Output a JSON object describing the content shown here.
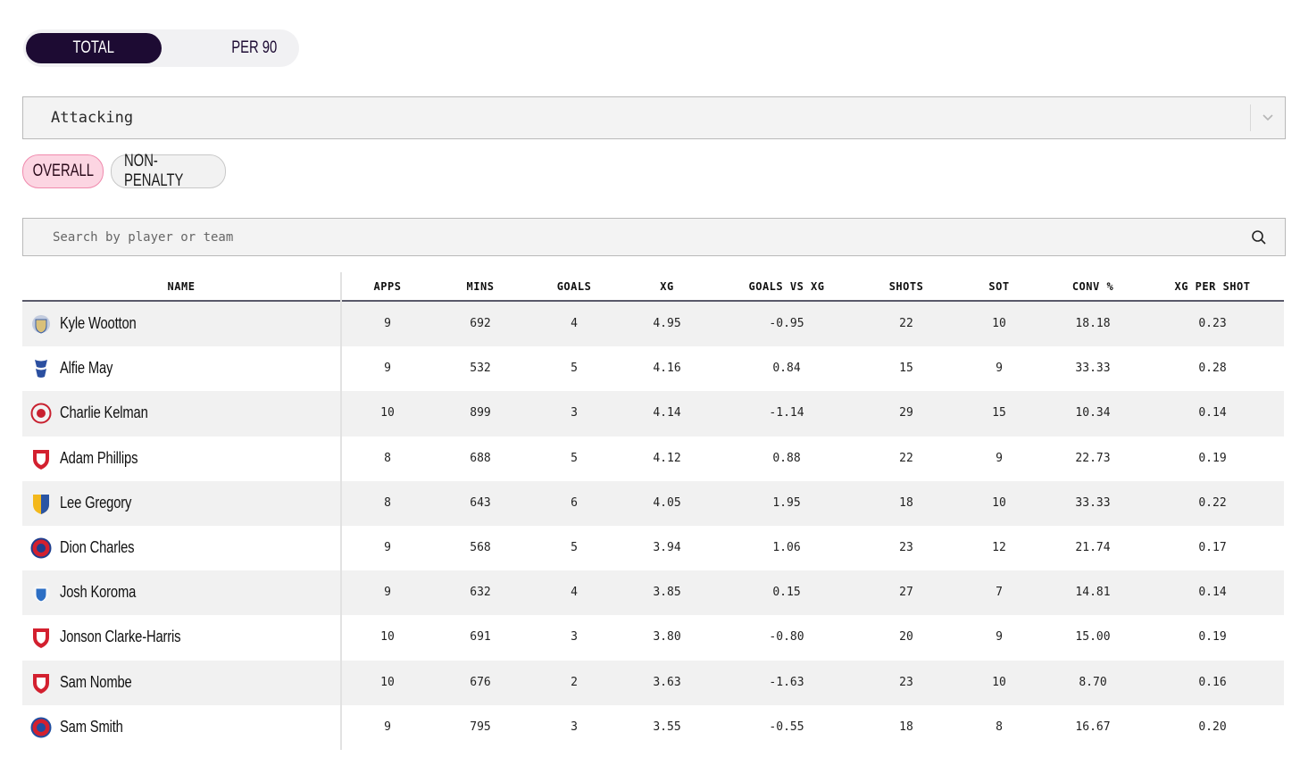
{
  "toggle": {
    "total": "TOTAL",
    "per90": "PER 90"
  },
  "category_select": {
    "value": "Attacking"
  },
  "filters": {
    "overall": "OVERALL",
    "non_penalty": "NON-PENALTY"
  },
  "search": {
    "placeholder": "Search by player or team",
    "icon": "search-icon"
  },
  "table": {
    "headers": [
      "NAME",
      "APPS",
      "MINS",
      "GOALS",
      "XG",
      "GOALS VS XG",
      "SHOTS",
      "SOT",
      "CONV %",
      "XG PER SHOT"
    ],
    "rows": [
      {
        "name": "Kyle Wootton",
        "cells": [
          "9",
          "692",
          "4",
          "4.95",
          "-0.95",
          "22",
          "10",
          "18.18",
          "0.23"
        ],
        "badge": "stockport-crest",
        "colors": [
          "#d9c07a",
          "#3a5fa8"
        ]
      },
      {
        "name": "Alfie May",
        "cells": [
          "9",
          "532",
          "5",
          "4.16",
          "0.84",
          "15",
          "9",
          "33.33",
          "0.28"
        ],
        "badge": "birmingham-crest",
        "colors": [
          "#2b4fa0",
          "#ffffff"
        ]
      },
      {
        "name": "Charlie Kelman",
        "cells": [
          "10",
          "899",
          "3",
          "4.14",
          "-1.14",
          "29",
          "15",
          "10.34",
          "0.14"
        ],
        "badge": "leyton-orient-crest",
        "colors": [
          "#c8202f",
          "#f2f2f2"
        ]
      },
      {
        "name": "Adam Phillips",
        "cells": [
          "8",
          "688",
          "5",
          "4.12",
          "0.88",
          "22",
          "9",
          "22.73",
          "0.19"
        ],
        "badge": "barnsley-crest",
        "colors": [
          "#d3202f",
          "#ffffff"
        ]
      },
      {
        "name": "Lee Gregory",
        "cells": [
          "8",
          "643",
          "6",
          "4.05",
          "1.95",
          "18",
          "10",
          "33.33",
          "0.22"
        ],
        "badge": "mansfield-crest",
        "colors": [
          "#f3b81c",
          "#2a55a4"
        ]
      },
      {
        "name": "Dion Charles",
        "cells": [
          "9",
          "568",
          "5",
          "3.94",
          "1.06",
          "23",
          "12",
          "21.74",
          "0.17"
        ],
        "badge": "bolton-crest",
        "colors": [
          "#1e3f8f",
          "#d3202f"
        ]
      },
      {
        "name": "Josh Koroma",
        "cells": [
          "9",
          "632",
          "4",
          "3.85",
          "0.15",
          "27",
          "7",
          "14.81",
          "0.14"
        ],
        "badge": "huddersfield-crest",
        "colors": [
          "#2d6fc4",
          "#ffffff"
        ]
      },
      {
        "name": "Jonson Clarke-Harris",
        "cells": [
          "10",
          "691",
          "3",
          "3.80",
          "-0.80",
          "20",
          "9",
          "15.00",
          "0.19"
        ],
        "badge": "rotherham-crest",
        "colors": [
          "#d3202f",
          "#ffffff"
        ]
      },
      {
        "name": "Sam Nombe",
        "cells": [
          "10",
          "676",
          "2",
          "3.63",
          "-1.63",
          "23",
          "10",
          "8.70",
          "0.16"
        ],
        "badge": "rotherham-crest",
        "colors": [
          "#d3202f",
          "#ffffff"
        ]
      },
      {
        "name": "Sam Smith",
        "cells": [
          "9",
          "795",
          "3",
          "3.55",
          "-0.55",
          "18",
          "8",
          "16.67",
          "0.20"
        ],
        "badge": "reading-crest",
        "colors": [
          "#1f4ea1",
          "#d3202f"
        ]
      }
    ]
  },
  "colors": {
    "toggle_active": "#1d0b33",
    "pill_active_bg": "#fcd5e2",
    "pill_active_border": "#f08aad",
    "row_stripe": "#f1f1f1"
  }
}
